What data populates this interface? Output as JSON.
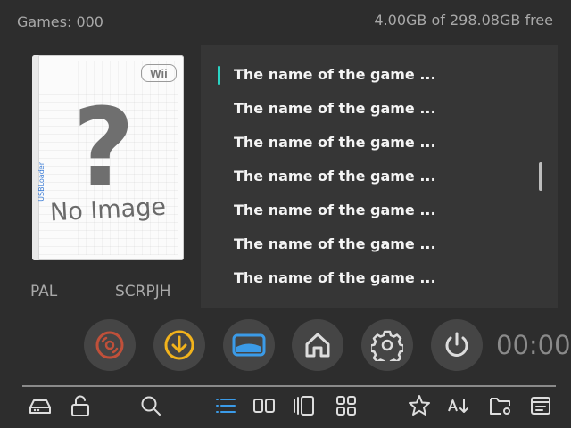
{
  "header": {
    "games_count": "Games: 000",
    "free_space": "4.00GB of 298.08GB free"
  },
  "cover": {
    "console_logo": "Wii",
    "placeholder_text": "No Image",
    "spine_text": "USBLoader"
  },
  "game_info": {
    "region": "PAL",
    "game_id": "SCRPJH"
  },
  "game_list": {
    "items": [
      "The name of the game ...",
      "The name of the game ...",
      "The name of the game ...",
      "The name of the game ...",
      "The name of the game ...",
      "The name of the game ...",
      "The name of the game ..."
    ],
    "selected_index": 0
  },
  "actions": [
    {
      "name": "disc-icon",
      "color": "#c0503a"
    },
    {
      "name": "download-icon",
      "color": "#f2b31c"
    },
    {
      "name": "wiiware-channel-icon",
      "color": "#3b9be8"
    },
    {
      "name": "home-icon",
      "color": "#dddddd"
    },
    {
      "name": "settings-gear-icon",
      "color": "#dddddd"
    },
    {
      "name": "power-icon",
      "color": "#dddddd"
    }
  ],
  "clock": "00:00",
  "toolbar": [
    "hdd-icon",
    "unlock-icon",
    "search-icon",
    "list-view-icon",
    "grid-two-icon",
    "carousel-view-icon",
    "grid-four-icon",
    "favorite-star-icon",
    "sort-az-icon",
    "folder-settings-icon",
    "file-manager-icon"
  ],
  "colors": {
    "background": "#2d2d2d",
    "panel": "#363636",
    "accent_cursor": "#2ad4c4",
    "active_tool": "#3b9be8"
  }
}
